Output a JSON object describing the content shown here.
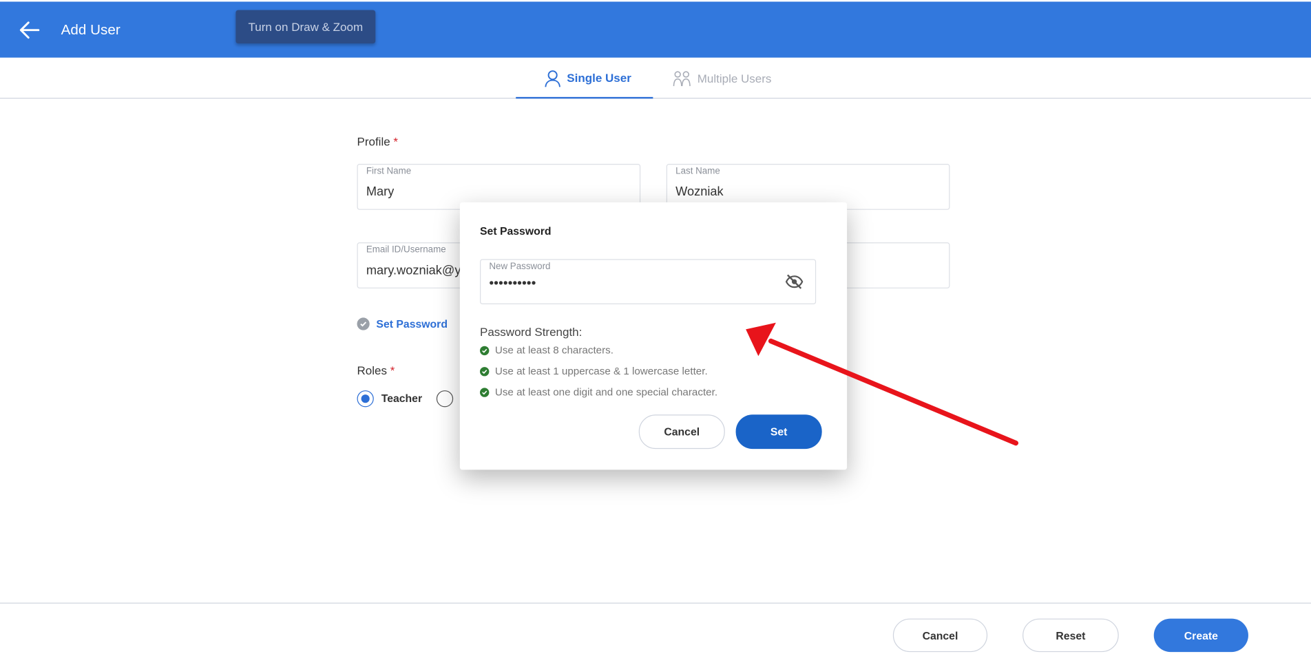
{
  "header": {
    "title": "Add User",
    "tooltip": "Turn on Draw & Zoom",
    "bg_color": "#3278dd"
  },
  "tabs": [
    {
      "label": "Single User",
      "active": true
    },
    {
      "label": "Multiple Users",
      "active": false
    }
  ],
  "profile": {
    "label": "Profile",
    "required_mark": "*",
    "first_name": {
      "label": "First Name",
      "value": "Mary"
    },
    "last_name": {
      "label": "Last Name",
      "value": "Wozniak"
    },
    "email": {
      "label": "Email ID/Username",
      "value": "mary.wozniak@yo"
    },
    "set_password_link": "Set Password"
  },
  "roles": {
    "label": "Roles",
    "required_mark": "*",
    "options": [
      {
        "label": "Teacher",
        "selected": true
      },
      {
        "label": "",
        "selected": false
      }
    ]
  },
  "dialog": {
    "title": "Set Password",
    "new_password": {
      "label": "New Password",
      "value": "••••••••••"
    },
    "strength_title": "Password Strength:",
    "rules": [
      "Use at least 8 characters.",
      "Use at least 1 uppercase & 1 lowercase letter.",
      "Use at least one digit and one special character."
    ],
    "cancel_label": "Cancel",
    "set_label": "Set"
  },
  "footer": {
    "cancel_label": "Cancel",
    "reset_label": "Reset",
    "create_label": "Create"
  },
  "colors": {
    "accent": "#3278dd",
    "check_green": "#2e7d32",
    "annotation_arrow": "#e8141b"
  },
  "icons": [
    "back-arrow-icon",
    "single-user-icon",
    "multiple-users-icon",
    "check-circle-icon",
    "eye-off-icon"
  ]
}
